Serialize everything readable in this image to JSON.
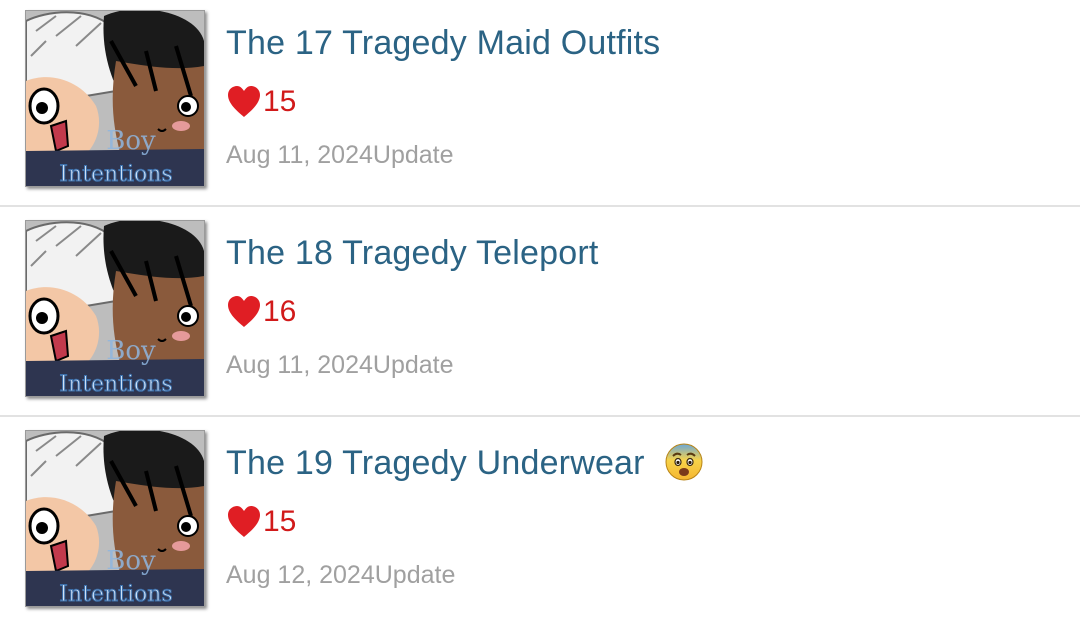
{
  "chapters": [
    {
      "title": "The 17 Tragedy Maid Outfits",
      "likes": "15",
      "date": "Aug 11, 2024",
      "status": "Update",
      "title_emoji": ""
    },
    {
      "title": "The 18 Tragedy Teleport",
      "likes": "16",
      "date": "Aug 11, 2024",
      "status": "Update",
      "title_emoji": ""
    },
    {
      "title": "The 19 Tragedy Underwear",
      "likes": "15",
      "date": "Aug 12, 2024",
      "status": "Update",
      "title_emoji": "😨"
    }
  ],
  "thumbnail": {
    "text_line_1": "Boy",
    "text_line_2": "Intentions"
  },
  "icons": {
    "like": "heart-icon",
    "emoji": "fearful-face-emoji-icon"
  },
  "colors": {
    "title": "#2b6384",
    "likes": "#d11a1a",
    "meta": "#a0a0a0",
    "divider": "#e2e2e2"
  }
}
